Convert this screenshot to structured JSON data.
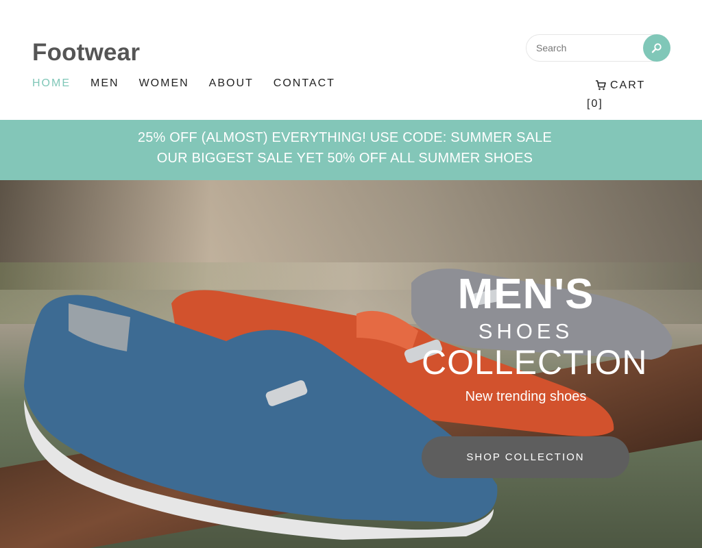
{
  "header": {
    "logo": "Footwear",
    "search": {
      "placeholder": "Search",
      "button_icon": "search-icon"
    },
    "nav": [
      {
        "label": "HOME",
        "active": true
      },
      {
        "label": "MEN",
        "active": false
      },
      {
        "label": "WOMEN",
        "active": false
      },
      {
        "label": "ABOUT",
        "active": false
      },
      {
        "label": "CONTACT",
        "active": false
      }
    ],
    "cart": {
      "icon": "cart-icon",
      "label": "CART",
      "count": "[0]"
    }
  },
  "promo": {
    "line1": "25% OFF (ALMOST) EVERYTHING! USE CODE: SUMMER SALE",
    "line2": "OUR BIGGEST SALE YET 50% OFF ALL SUMMER SHOES"
  },
  "hero": {
    "title1": "MEN'S",
    "title2": "SHOES",
    "title3": "COLLECTION",
    "subtitle": "New trending shoes",
    "button": "SHOP COLLECTION"
  },
  "colors": {
    "accent": "#80c7b8",
    "promo_bg": "#83c6b8",
    "button_bg": "#5e5e5e",
    "logo": "#555555"
  }
}
